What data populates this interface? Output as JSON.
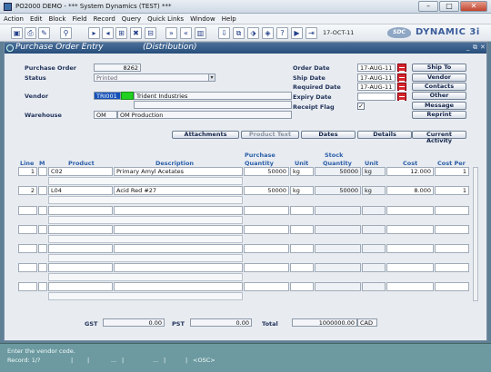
{
  "window": {
    "title": "PO2000 DEMO - *** System Dynamics (TEST) ***"
  },
  "menu": [
    "Action",
    "Edit",
    "Block",
    "Field",
    "Record",
    "Query",
    "Quick Links",
    "Window",
    "Help"
  ],
  "toolbar": {
    "date": "17-OCT-11",
    "logo_mark": "SDC",
    "logo_text": "DYNAMIC 3i"
  },
  "form": {
    "title": "Purchase Order Entry",
    "subtitle": "(Distribution)",
    "purchase_order_label": "Purchase Order",
    "purchase_order": "8262",
    "status_label": "Status",
    "status": "Printed",
    "vendor_label": "Vendor",
    "vendor_code": "TRI001",
    "vendor_name": "Trident Industries",
    "warehouse_label": "Warehouse",
    "warehouse_code": "OM",
    "warehouse_name": "OM Production",
    "order_date_label": "Order Date",
    "order_date": "17-AUG-11",
    "ship_date_label": "Ship Date",
    "ship_date": "17-AUG-11",
    "required_date_label": "Required Date",
    "required_date": "17-AUG-11",
    "expiry_date_label": "Expiry Date",
    "expiry_date": "",
    "receipt_flag_label": "Receipt Flag",
    "receipt_flag": "✓"
  },
  "side_buttons": [
    "Ship To",
    "Vendor",
    "Contacts",
    "Other",
    "Message",
    "Reprint"
  ],
  "tab_buttons": [
    "Attachments",
    "Product Text",
    "Dates",
    "Details",
    "Current Activity"
  ],
  "grid": {
    "headers": {
      "line": "Line",
      "m": "M",
      "product": "Product",
      "description": "Description",
      "purchase_quantity_1": "Purchase",
      "purchase_quantity_2": "Quantity",
      "unit": "Unit",
      "stock_quantity_1": "Stock",
      "stock_quantity_2": "Quantity",
      "unit2": "Unit",
      "cost": "Cost",
      "cost_per": "Cost Per"
    },
    "rows": [
      {
        "line": "1",
        "m": "",
        "product": "C02",
        "description": "Primary Amyl Acetates",
        "purchase_qty": "50000",
        "unit": "kg",
        "stock_qty": "50000",
        "stock_unit": "kg",
        "cost": "12.000",
        "cost_per": "1"
      },
      {
        "line": "2",
        "m": "",
        "product": "L04",
        "description": "Acid Red #27",
        "purchase_qty": "50000",
        "unit": "kg",
        "stock_qty": "50000",
        "stock_unit": "kg",
        "cost": "8.000",
        "cost_per": "1"
      }
    ]
  },
  "totals": {
    "gst_label": "GST",
    "gst": "0.00",
    "pst_label": "PST",
    "pst": "0.00",
    "total_label": "Total",
    "total": "1000000.00",
    "currency": "CAD"
  },
  "status": {
    "message": "Enter the vendor code.",
    "record": "Record: 1/?",
    "osc": "<OSC>"
  },
  "colors": {
    "title_bar": "#274d7a",
    "status_bar": "#6c9aa0",
    "selected_field": "#1450b8"
  }
}
